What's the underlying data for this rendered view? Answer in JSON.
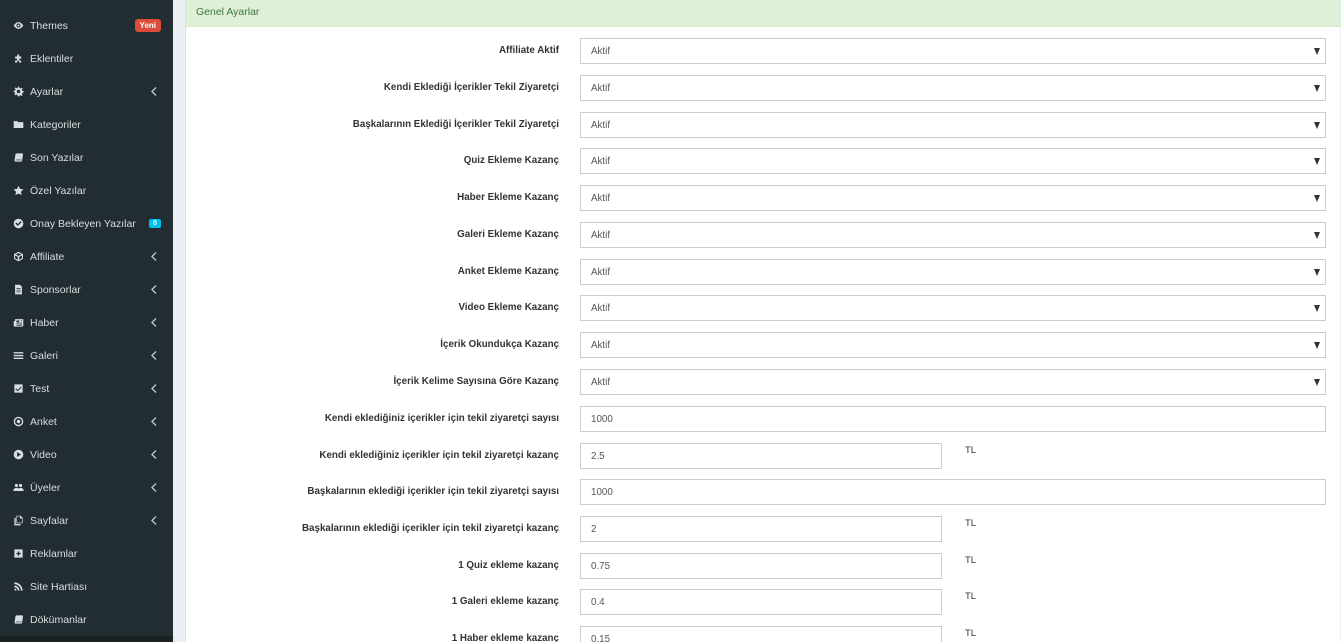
{
  "sidebar": {
    "items": [
      {
        "label": "Themes",
        "icon": "eye-icon",
        "badge": "Yeni",
        "badge_color": "#dd4b39"
      },
      {
        "label": "Eklentiler",
        "icon": "puzzle-icon"
      },
      {
        "label": "Ayarlar",
        "icon": "gear-icon",
        "chevron": true
      },
      {
        "label": "Kategoriler",
        "icon": "folder-icon"
      },
      {
        "label": "Son Yazılar",
        "icon": "book-icon"
      },
      {
        "label": "Özel Yazılar",
        "icon": "star-icon"
      },
      {
        "label": "Onay Bekleyen Yazılar",
        "icon": "check-circle-icon",
        "badge": "0",
        "badge_color": "#00c0ef"
      },
      {
        "label": "Affiliate",
        "icon": "cube-icon",
        "chevron": true
      },
      {
        "label": "Sponsorlar",
        "icon": "file-text-icon",
        "chevron": true
      },
      {
        "label": "Haber",
        "icon": "newspaper-icon",
        "chevron": true
      },
      {
        "label": "Galeri",
        "icon": "bars-icon",
        "chevron": true
      },
      {
        "label": "Test",
        "icon": "check-square-icon",
        "chevron": true
      },
      {
        "label": "Anket",
        "icon": "dot-circle-icon",
        "chevron": true
      },
      {
        "label": "Video",
        "icon": "play-circle-icon",
        "chevron": true
      },
      {
        "label": "Üyeler",
        "icon": "users-icon",
        "chevron": true
      },
      {
        "label": "Sayfalar",
        "icon": "copy-icon",
        "chevron": true
      },
      {
        "label": "Reklamlar",
        "icon": "plus-square-icon"
      },
      {
        "label": "Site Hartiası",
        "icon": "rss-icon"
      },
      {
        "label": "Dökümanlar",
        "icon": "book-icon"
      }
    ]
  },
  "panel": {
    "title": "Genel Ayarlar"
  },
  "settings": [
    {
      "label": "Affiliate Aktif",
      "type": "select",
      "value": "Aktif"
    },
    {
      "label": "Kendi Eklediği İçerikler Tekil Ziyaretçi",
      "type": "select",
      "value": "Aktif"
    },
    {
      "label": "Başkalarının Eklediği İçerikler Tekil Ziyaretçi",
      "type": "select",
      "value": "Aktif"
    },
    {
      "label": "Quiz Ekleme Kazanç",
      "type": "select",
      "value": "Aktif"
    },
    {
      "label": "Haber Ekleme Kazanç",
      "type": "select",
      "value": "Aktif"
    },
    {
      "label": "Galeri Ekleme Kazanç",
      "type": "select",
      "value": "Aktif"
    },
    {
      "label": "Anket Ekleme Kazanç",
      "type": "select",
      "value": "Aktif"
    },
    {
      "label": "Video Ekleme Kazanç",
      "type": "select",
      "value": "Aktif"
    },
    {
      "label": "İçerik Okundukça Kazanç",
      "type": "select",
      "value": "Aktif"
    },
    {
      "label": "İçerik Kelime Sayısına Göre Kazanç",
      "type": "select",
      "value": "Aktif"
    },
    {
      "label": "Kendi eklediğiniz içerikler için tekil ziyaretçi sayısı",
      "type": "input",
      "value": "1000"
    },
    {
      "label": "Kendi eklediğiniz içerikler için tekil ziyaretçi kazanç",
      "type": "input-unit",
      "value": "2.5",
      "unit": "TL"
    },
    {
      "label": "Başkalarının eklediği içerikler için tekil ziyaretçi sayısı",
      "type": "input",
      "value": "1000"
    },
    {
      "label": "Başkalarının eklediği içerikler için tekil ziyaretçi kazanç",
      "type": "input-unit",
      "value": "2",
      "unit": "TL"
    },
    {
      "label": "1 Quiz ekleme kazanç",
      "type": "input-unit",
      "value": "0.75",
      "unit": "TL"
    },
    {
      "label": "1 Galeri ekleme kazanç",
      "type": "input-unit",
      "value": "0.4",
      "unit": "TL"
    },
    {
      "label": "1 Haber ekleme kazanç",
      "type": "input-unit",
      "value": "0.15",
      "unit": "TL"
    }
  ]
}
